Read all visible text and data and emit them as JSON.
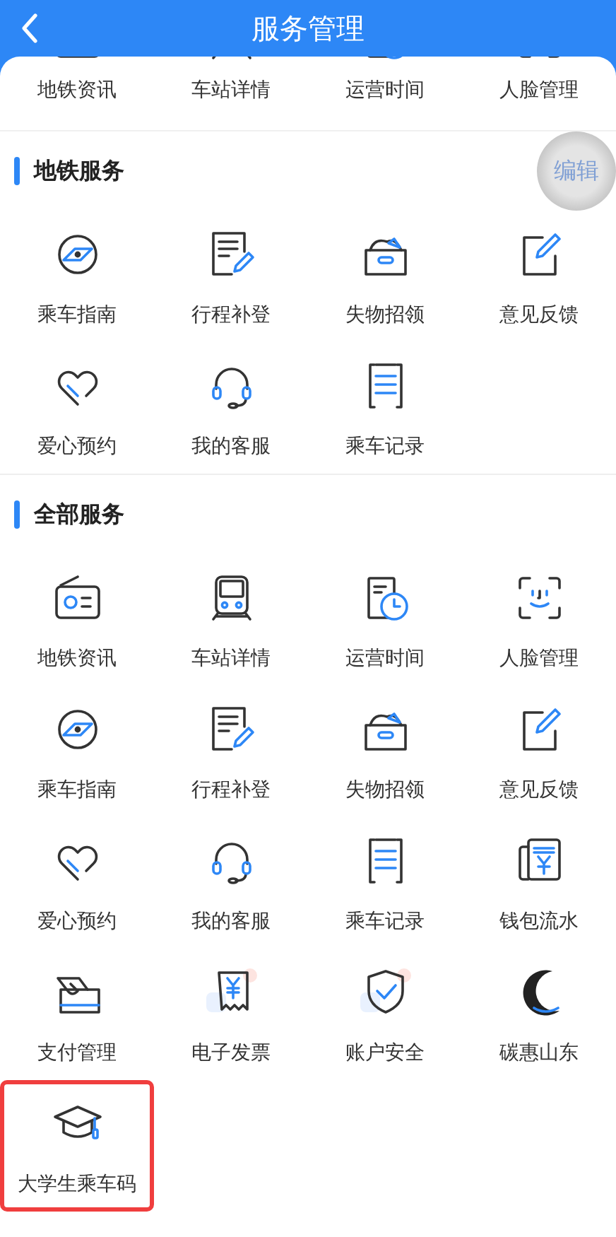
{
  "header": {
    "title": "服务管理"
  },
  "partial_row": [
    {
      "label": "地铁资讯",
      "kind": "radio"
    },
    {
      "label": "车站详情",
      "kind": "train"
    },
    {
      "label": "运营时间",
      "kind": "schedule"
    },
    {
      "label": "人脸管理",
      "kind": "face"
    }
  ],
  "sections": [
    {
      "title": "地铁服务",
      "edit_button": "编辑",
      "items": [
        {
          "label": "乘车指南",
          "kind": "compass",
          "highlighted": false
        },
        {
          "label": "行程补登",
          "kind": "doc-pen",
          "highlighted": false
        },
        {
          "label": "失物招领",
          "kind": "box",
          "highlighted": false
        },
        {
          "label": "意见反馈",
          "kind": "edit",
          "highlighted": false
        },
        {
          "label": "爱心预约",
          "kind": "heart",
          "highlighted": false
        },
        {
          "label": "我的客服",
          "kind": "headset",
          "highlighted": false
        },
        {
          "label": "乘车记录",
          "kind": "list",
          "highlighted": false
        }
      ]
    },
    {
      "title": "全部服务",
      "items": [
        {
          "label": "地铁资讯",
          "kind": "radio",
          "highlighted": false
        },
        {
          "label": "车站详情",
          "kind": "train",
          "highlighted": false
        },
        {
          "label": "运营时间",
          "kind": "schedule",
          "highlighted": false
        },
        {
          "label": "人脸管理",
          "kind": "face",
          "highlighted": false
        },
        {
          "label": "乘车指南",
          "kind": "compass",
          "highlighted": false
        },
        {
          "label": "行程补登",
          "kind": "doc-pen",
          "highlighted": false
        },
        {
          "label": "失物招领",
          "kind": "box",
          "highlighted": false
        },
        {
          "label": "意见反馈",
          "kind": "edit",
          "highlighted": false
        },
        {
          "label": "爱心预约",
          "kind": "heart",
          "highlighted": false
        },
        {
          "label": "我的客服",
          "kind": "headset",
          "highlighted": false
        },
        {
          "label": "乘车记录",
          "kind": "list",
          "highlighted": false
        },
        {
          "label": "钱包流水",
          "kind": "bill",
          "highlighted": false
        },
        {
          "label": "支付管理",
          "kind": "card",
          "highlighted": false
        },
        {
          "label": "电子发票",
          "kind": "receipt",
          "highlighted": false
        },
        {
          "label": "账户安全",
          "kind": "shield",
          "highlighted": false
        },
        {
          "label": "碳惠山东",
          "kind": "crescent",
          "highlighted": false
        },
        {
          "label": "大学生乘车码",
          "kind": "cap",
          "highlighted": true
        }
      ]
    }
  ]
}
